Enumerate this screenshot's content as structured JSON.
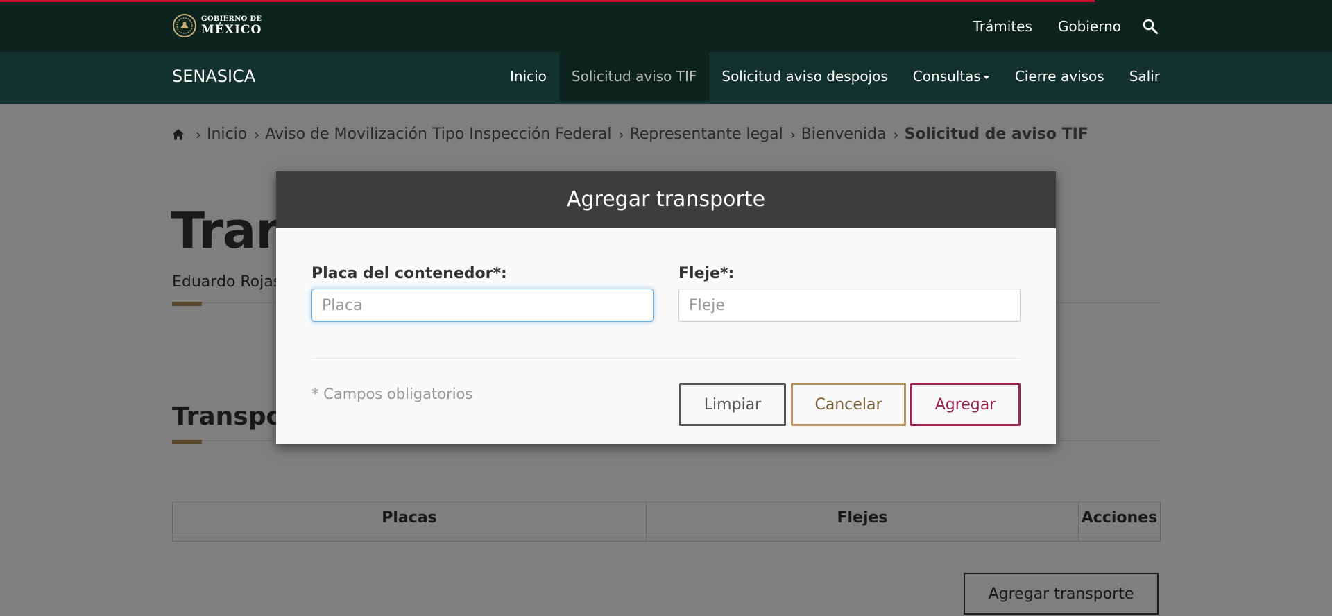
{
  "header": {
    "logo": {
      "line1": "GOBIERNO DE",
      "line2": "MÉXICO"
    },
    "top_links": [
      "Trámites",
      "Gobierno"
    ],
    "search_icon": "search-icon"
  },
  "navbar": {
    "brand": "SENASICA",
    "items": [
      "Inicio",
      "Solicitud aviso TIF",
      "Solicitud aviso despojos",
      "Consultas",
      "Cierre avisos",
      "Salir"
    ],
    "active": "Solicitud aviso TIF"
  },
  "breadcrumb": {
    "items": [
      "Inicio",
      "Aviso de Movilización Tipo Inspección Federal",
      "Representante legal",
      "Bienvenida"
    ],
    "current": "Solicitud de aviso TIF"
  },
  "page": {
    "title": "Transporte",
    "subtitle": "Eduardo Rojas Cr",
    "section_title": "Transportes agregados*:"
  },
  "table": {
    "headers": [
      "Placas",
      "Flejes",
      "Acciones"
    ]
  },
  "add_transport_button": "Agregar transporte",
  "modal": {
    "title": "Agregar transporte",
    "plate_label": "Placa del contenedor*:",
    "plate_placeholder": "Placa",
    "seal_label": "Fleje*:",
    "seal_placeholder": "Fleje",
    "required_note": "* Campos obligatorios",
    "buttons": {
      "clear": "Limpiar",
      "cancel": "Cancelar",
      "add": "Agregar"
    }
  },
  "colors": {
    "topbar": "#0c231e",
    "navbar": "#13322b",
    "gold": "#b38e5d",
    "wine": "#9d2449",
    "loading_bar": "#d0112b"
  }
}
